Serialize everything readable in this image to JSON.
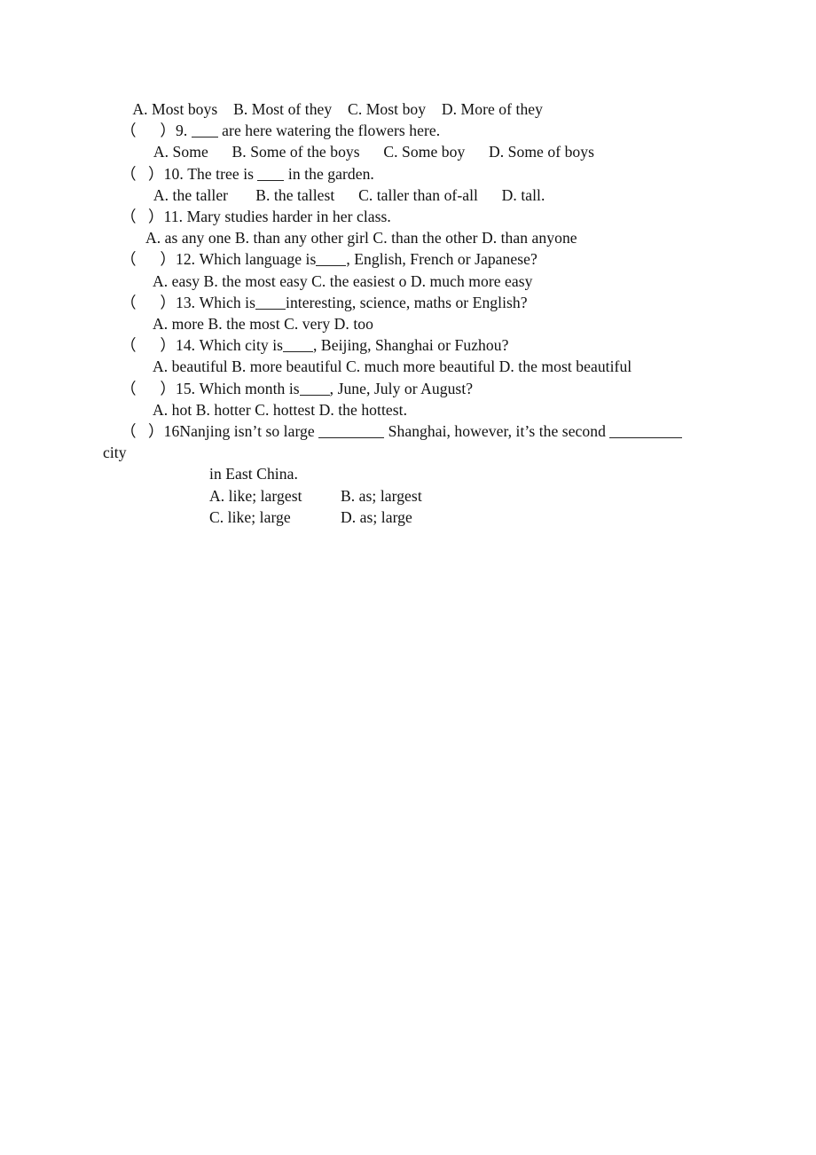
{
  "document": {
    "type": "english-grammar-multiple-choice-worksheet",
    "background_color": "#ffffff",
    "text_color": "#111111"
  },
  "lines": {
    "q8_options": "   A. Most boys    B. Most of they    C. Most boy    D. More of they",
    "q9_marker": "（      ）9. ",
    "q9_stem_after_blank": " are here watering the flowers here.",
    "q9_options": "  A. Some      B. Some of the boys      C. Some boy      D. Some of boys",
    "q10_marker": "（   ）10. The tree is ",
    "q10_stem_after_blank": " in the garden.",
    "q10_options": "  A. the taller       B. the tallest      C. taller than of-all      D. tall.",
    "q11_marker": "（   ）11. Mary studies harder in her class.",
    "q11_options": "A. as any one B. than any other girl C. than the other D. than anyone",
    "q12_marker": "（      ）12. Which language is",
    "q12_stem_after_blank": ", English, French or Japanese?",
    "q12_options": "A. easy B. the most easy C. the easiest o D. much more easy",
    "q13_marker": "（      ）13. Which is",
    "q13_stem_after_blank": "interesting, science, maths or English?",
    "q13_options": "A. more B. the most C. very D. too",
    "q14_marker": "（      ）14. Which city is",
    "q14_stem_after_blank": ", Beijing, Shanghai or Fuzhou?",
    "q14_options": "A. beautiful B. more beautiful C. much more beautiful D. the most beautiful",
    "q15_marker": "（      ）15. Which month is",
    "q15_stem_after_blank": ", June, July or August?",
    "q15_options": "A. hot B. hotter C. hottest D. the hottest.",
    "q16_marker": "（   ）16Nanjing isn’t so large ",
    "q16_mid": " Shanghai, however, it’s the second ",
    "q16_overflow": "city",
    "q16_continuation": "in East China.",
    "q16_option_a": "A. like; largest",
    "q16_option_b": "B. as; largest",
    "q16_option_c": "C. like; large",
    "q16_option_d": "D. as; large"
  }
}
